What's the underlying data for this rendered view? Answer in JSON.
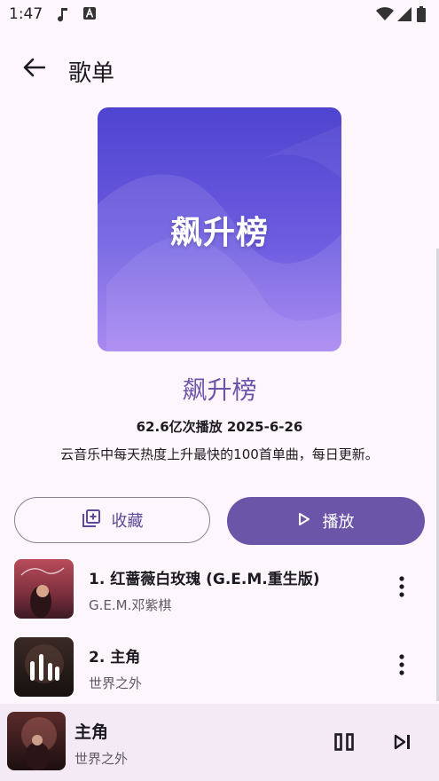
{
  "status_bar": {
    "time": "1:47"
  },
  "top_bar": {
    "title": "歌单"
  },
  "playlist": {
    "cover_text": "飙升榜",
    "name": "飙升榜",
    "stats": "62.6亿次播放 2025-6-26",
    "description": "云音乐中每天热度上升最快的100首单曲，每日更新。"
  },
  "actions": {
    "collect_label": "收藏",
    "play_label": "播放"
  },
  "songs": [
    {
      "title": "1. 红蔷薇白玫瑰 (G.E.M.重生版)",
      "artist": "G.E.M.邓紫棋"
    },
    {
      "title": "2. 主角",
      "artist": "世界之外"
    }
  ],
  "now_playing": {
    "title": "主角",
    "artist": "世界之外"
  },
  "colors": {
    "accent": "#6a55a8",
    "background": "#fdf6fd",
    "cover_top": "#4f44cf",
    "cover_bottom": "#a07cf0"
  }
}
